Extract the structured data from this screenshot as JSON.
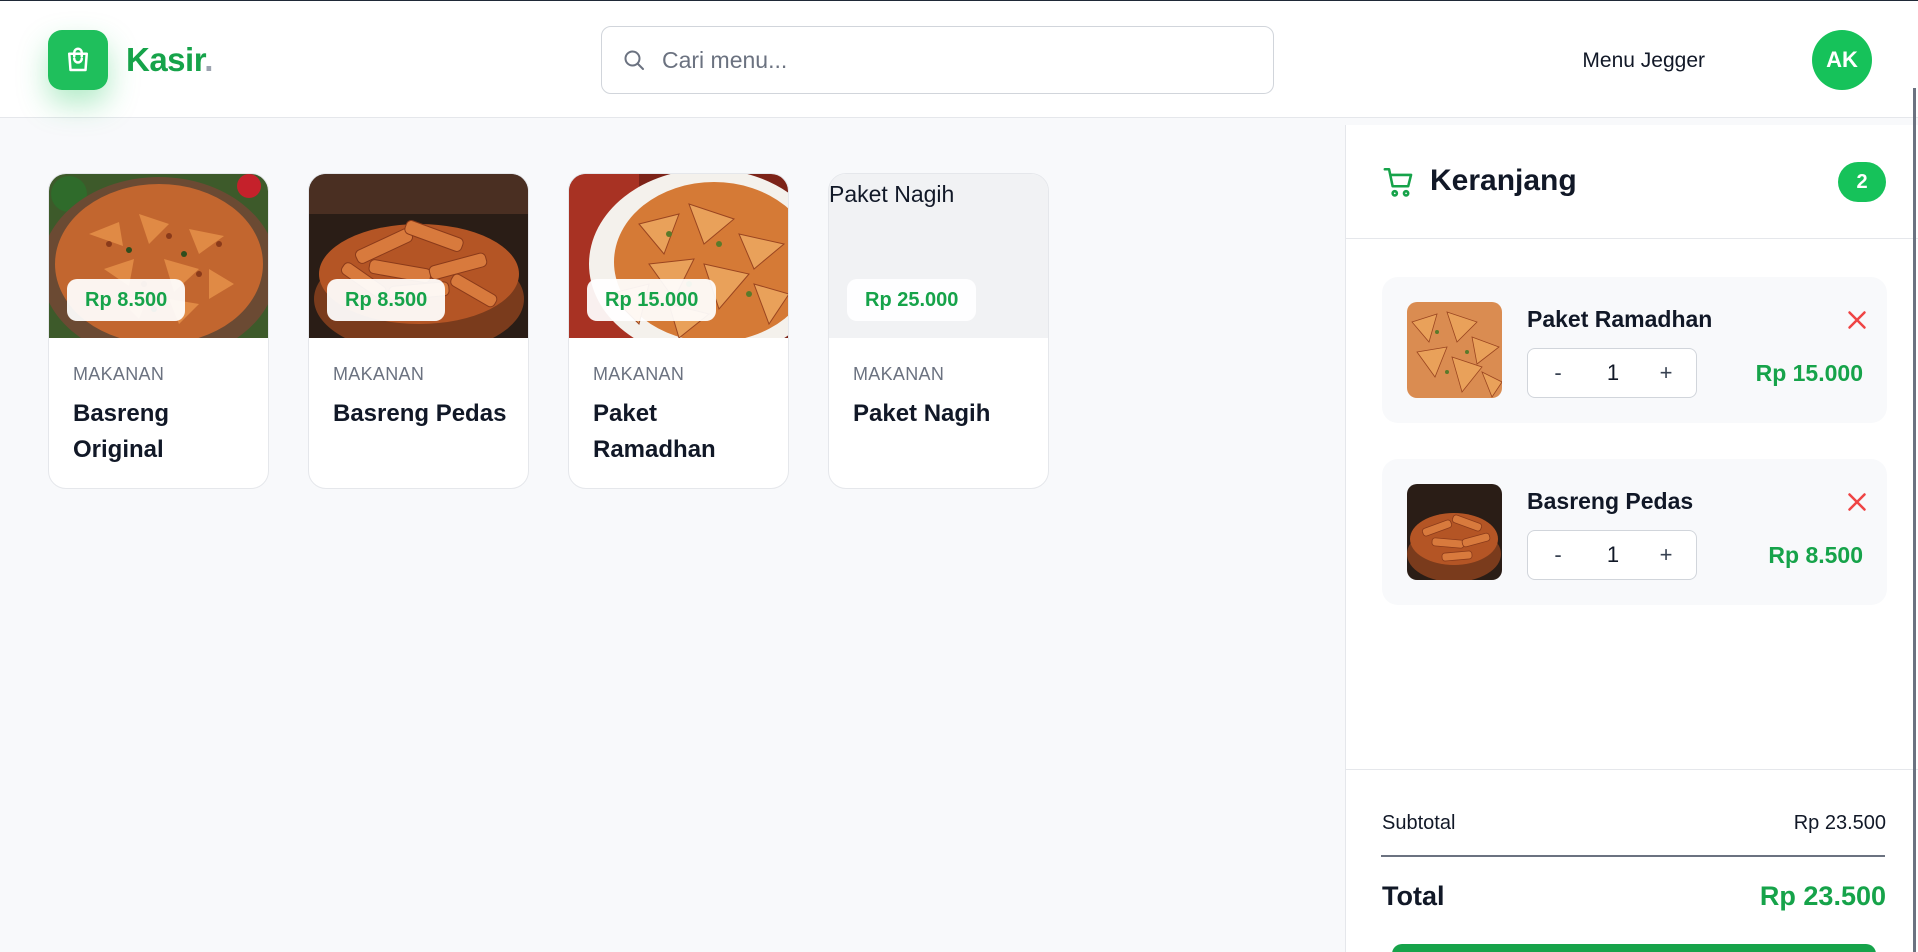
{
  "header": {
    "logo_text": "Kasir",
    "logo_dot": ".",
    "search_placeholder": "Cari menu...",
    "user_name": "Menu Jegger",
    "avatar_initials": "AK"
  },
  "products": [
    {
      "category": "MAKANAN",
      "name": "Basreng Original",
      "price": "Rp 8.500",
      "image": "basreng-chips-bowl"
    },
    {
      "category": "MAKANAN",
      "name": "Basreng Pedas",
      "price": "Rp 8.500",
      "image": "basreng-sticks-bowl"
    },
    {
      "category": "MAKANAN",
      "name": "Paket Ramadhan",
      "price": "Rp 15.000",
      "image": "basreng-plate"
    },
    {
      "category": "MAKANAN",
      "name": "Paket Nagih",
      "price": "Rp 25.000",
      "image_alt": "Paket Nagih"
    }
  ],
  "cart": {
    "title": "Keranjang",
    "count": "2",
    "items": [
      {
        "name": "Paket Ramadhan",
        "qty": "1",
        "price": "Rp 15.000",
        "minus": "-",
        "plus": "+"
      },
      {
        "name": "Basreng Pedas",
        "qty": "1",
        "price": "Rp 8.500",
        "minus": "-",
        "plus": "+"
      }
    ],
    "subtotal_label": "Subtotal",
    "subtotal_value": "Rp 23.500",
    "total_label": "Total",
    "total_value": "Rp 23.500"
  },
  "colors": {
    "brand_green": "#16a34a",
    "remove_red": "#ef4444"
  }
}
